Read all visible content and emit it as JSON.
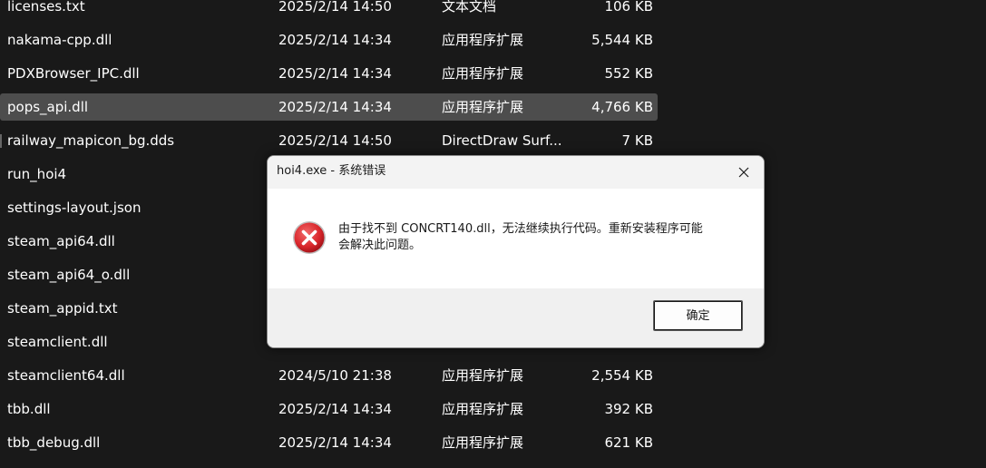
{
  "files": [
    {
      "name": "licenses.txt",
      "date": "2025/2/14 14:50",
      "type": "文本文档",
      "size": "106 KB"
    },
    {
      "name": "nakama-cpp.dll",
      "date": "2025/2/14 14:34",
      "type": "应用程序扩展",
      "size": "5,544 KB"
    },
    {
      "name": "PDXBrowser_IPC.dll",
      "date": "2025/2/14 14:34",
      "type": "应用程序扩展",
      "size": "552 KB"
    },
    {
      "name": "pops_api.dll",
      "date": "2025/2/14 14:34",
      "type": "应用程序扩展",
      "size": "4,766 KB",
      "selected": true
    },
    {
      "name": "railway_mapicon_bg.dds",
      "date": "2025/2/14 14:50",
      "type": "DirectDraw Surf...",
      "size": "7 KB",
      "icon": true
    },
    {
      "name": "run_hoi4",
      "date": "",
      "type": "",
      "size": ""
    },
    {
      "name": "settings-layout.json",
      "date": "",
      "type": "",
      "size": ""
    },
    {
      "name": "steam_api64.dll",
      "date": "",
      "type": "",
      "size": ""
    },
    {
      "name": "steam_api64_o.dll",
      "date": "",
      "type": "",
      "size": ""
    },
    {
      "name": "steam_appid.txt",
      "date": "",
      "type": "",
      "size": ""
    },
    {
      "name": "steamclient.dll",
      "date": "",
      "type": "",
      "size": ""
    },
    {
      "name": "steamclient64.dll",
      "date": "2024/5/10 21:38",
      "type": "应用程序扩展",
      "size": "2,554 KB"
    },
    {
      "name": "tbb.dll",
      "date": "2025/2/14 14:34",
      "type": "应用程序扩展",
      "size": "392 KB"
    },
    {
      "name": "tbb_debug.dll",
      "date": "2025/2/14 14:34",
      "type": "应用程序扩展",
      "size": "621 KB"
    }
  ],
  "dialog": {
    "title": "hoi4.exe - 系统错误",
    "message_line1": "由于找不到 CONCRT140.dll，无法继续执行代码。重新安装程序可能",
    "message_line2": "会解决此问题。",
    "ok_label": "确定",
    "icon": "error-icon"
  },
  "colors": {
    "background": "#191919",
    "selected_row": "#4d4d4d",
    "error_red": "#d9262b"
  }
}
